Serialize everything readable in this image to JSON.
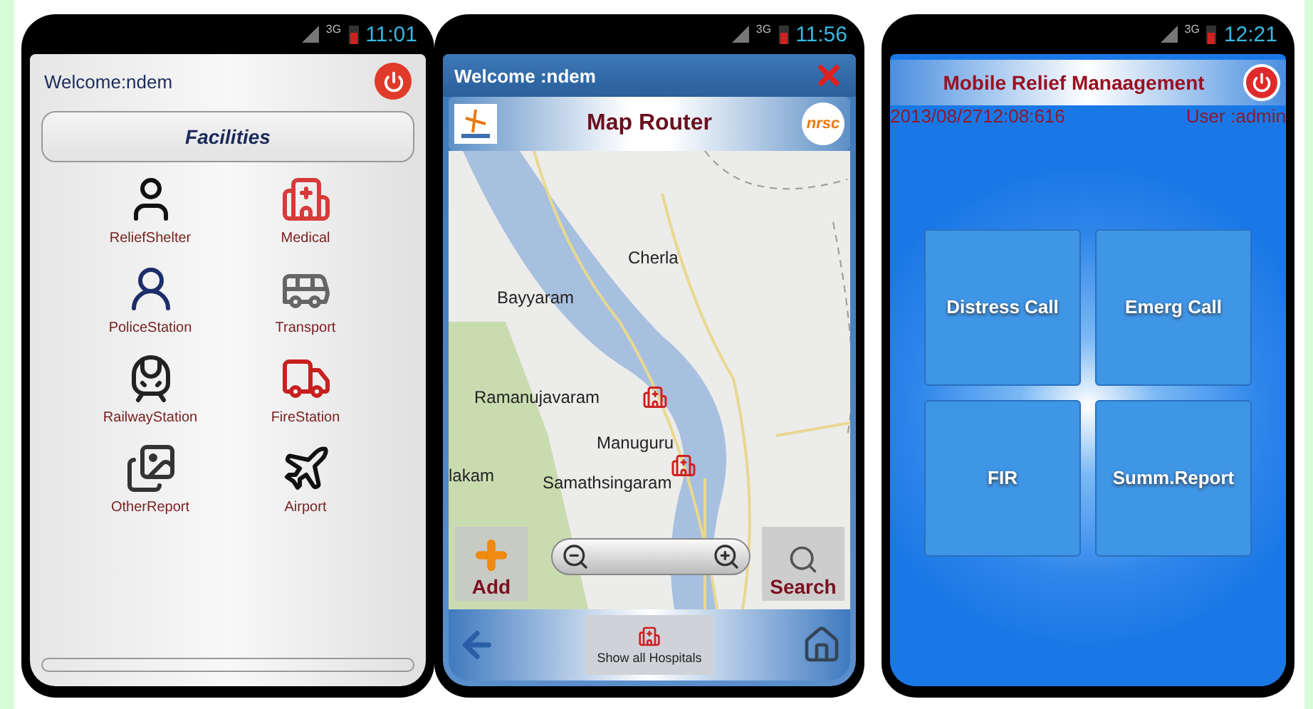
{
  "screens": [
    {
      "kind": "facilities",
      "signal_label": "3G",
      "status_time": "11:01",
      "welcome": "Welcome:ndem",
      "title": "Facilities",
      "items": [
        {
          "label": "ReliefShelter"
        },
        {
          "label": "Medical"
        },
        {
          "label": "PoliceStation"
        },
        {
          "label": "Transport"
        },
        {
          "label": "RailwayStation"
        },
        {
          "label": "FireStation"
        },
        {
          "label": "OtherReport"
        },
        {
          "label": "Airport"
        }
      ]
    },
    {
      "kind": "map",
      "signal_label": "3G",
      "status_time": "11:56",
      "welcome": "Welcome :ndem",
      "title": "Map Router",
      "logo_text": "nrsc",
      "map_labels": [
        "Cherla",
        "Bayyaram",
        "Ramanujavaram",
        "Manuguru",
        "lakam",
        "Samathsingaram"
      ],
      "add_label": "Add",
      "search_label": "Search",
      "bottom_button": "Show all Hospitals"
    },
    {
      "kind": "menu",
      "signal_label": "3G",
      "status_time": "12:21",
      "title": "Mobile Relief Manaagement",
      "timestamp": "2013/08/2712:08:616",
      "user": "User :admin",
      "buttons": [
        {
          "label": "Distress Call"
        },
        {
          "label": "Emerg Call"
        },
        {
          "label": "FIR"
        },
        {
          "label": "Summ.Report"
        }
      ]
    }
  ]
}
